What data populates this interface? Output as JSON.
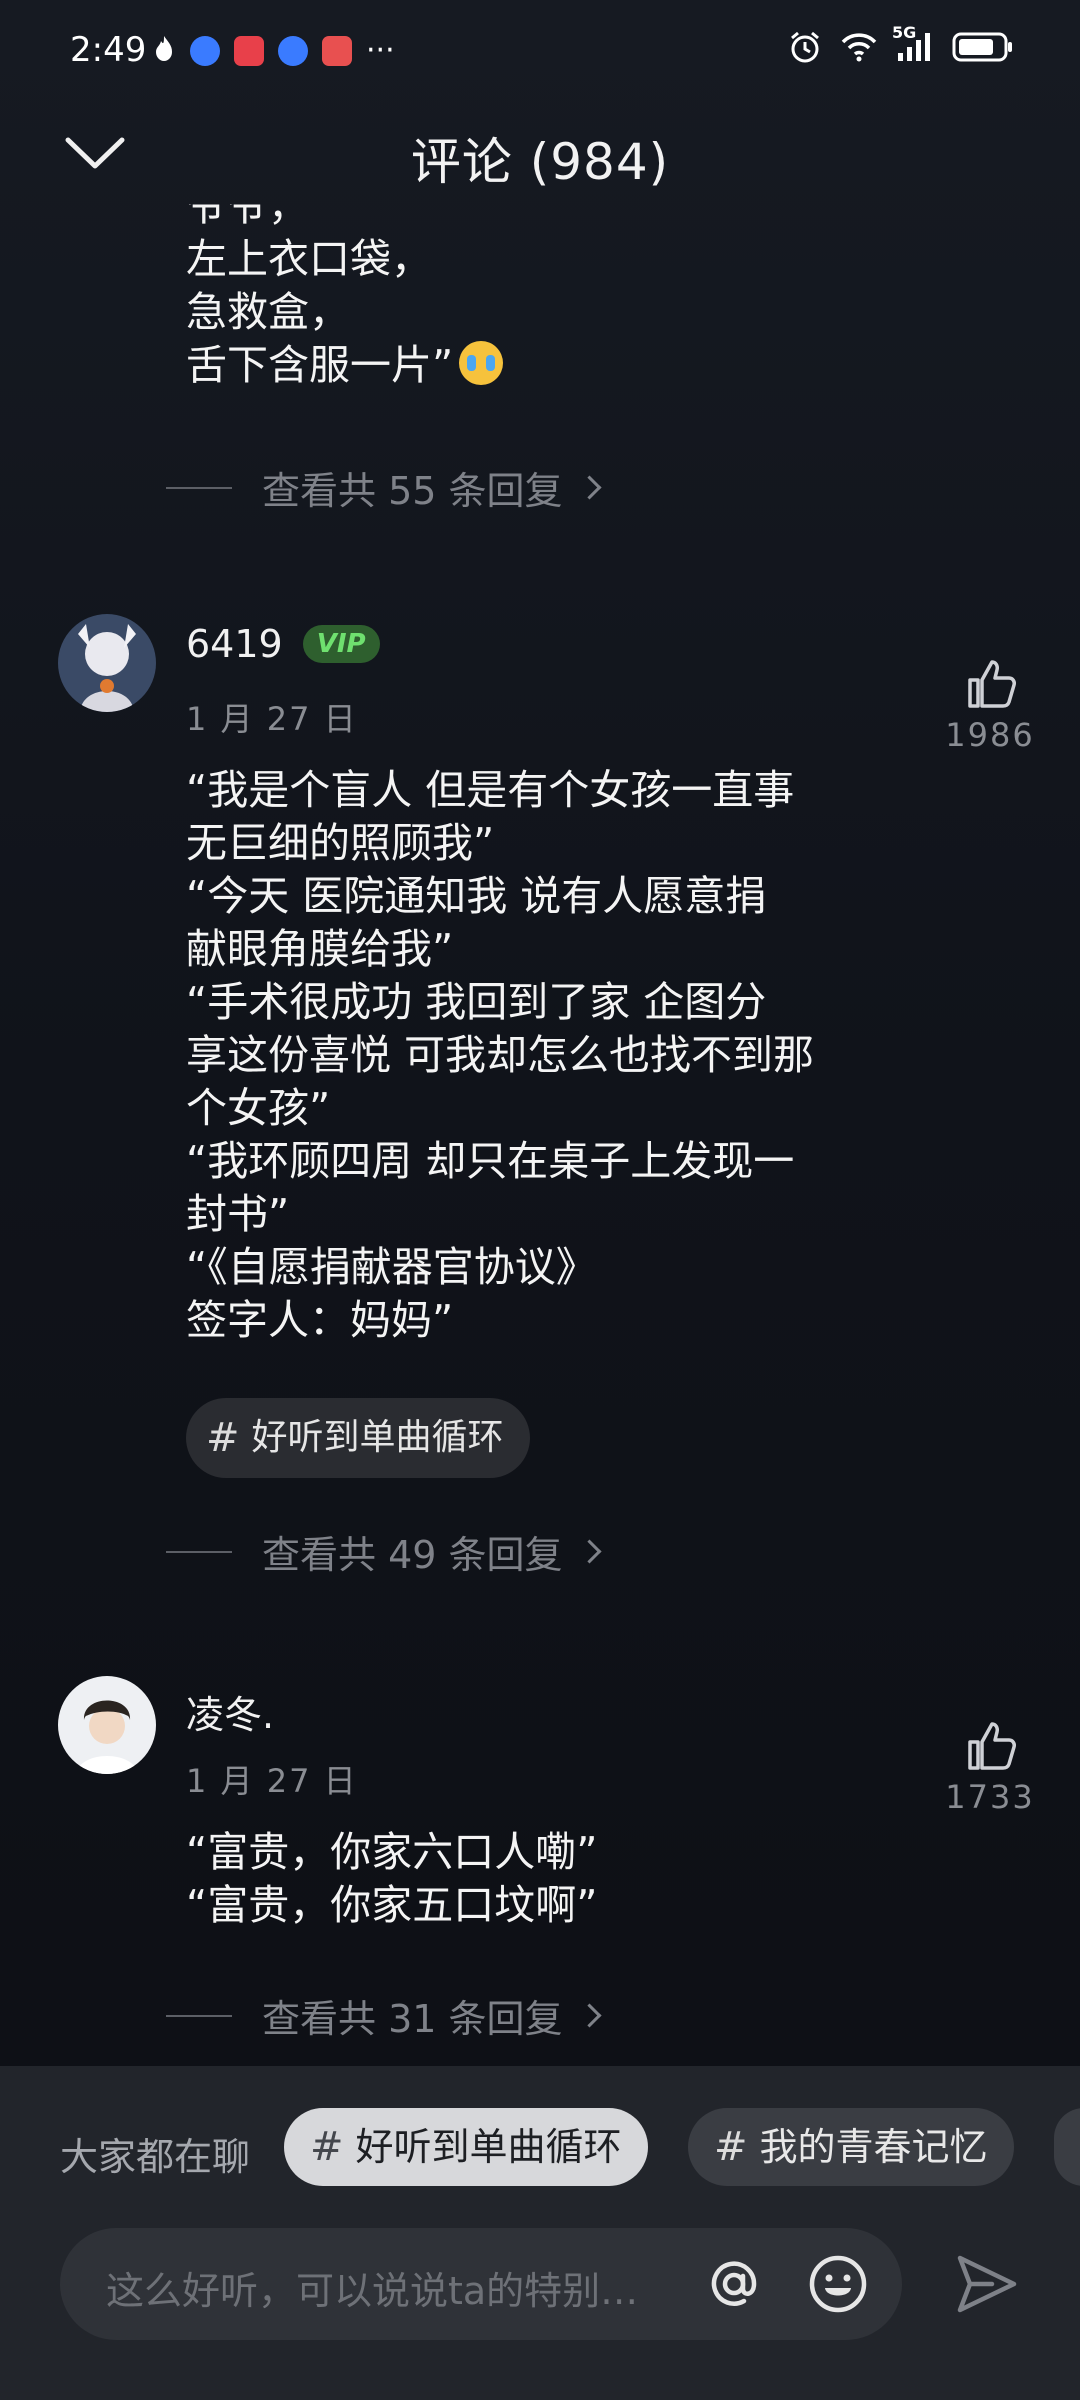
{
  "status_bar": {
    "time": "2:49",
    "overflow": "···",
    "network": "5G",
    "left_icons": [
      "flame-icon",
      "browser-icon",
      "app-icon",
      "browser-icon",
      "book-icon"
    ],
    "right_icons": [
      "alarm-icon",
      "wifi-icon",
      "signal-icon",
      "battery-icon"
    ]
  },
  "header": {
    "title": "评论 (984)",
    "collapse_icon": "chevron-down-icon"
  },
  "previous_comment": {
    "lines": [
      "爷爷，",
      "左上衣口袋，",
      "急救盒，",
      "舌下含服一片”"
    ],
    "emoji": "crying-face",
    "replies_label": "查看共 55 条回复"
  },
  "comments": [
    {
      "username": "6419",
      "badge": "VIP",
      "date": "1 月 27 日",
      "likes": "1986",
      "lines": [
        "“我是个盲人 但是有个女孩一直事",
        "无巨细的照顾我”",
        "“今天 医院通知我 说有人愿意捐",
        "献眼角膜给我”",
        "“手术很成功 我回到了家 企图分",
        "享这份喜悦 可我却怎么也找不到那",
        "个女孩”",
        "“我环顾四周 却只在桌子上发现一",
        "封书”",
        "“《自愿捐献器官协议》",
        " 签字人：妈妈”"
      ],
      "topic_tag": "好听到单曲循环",
      "replies_label": "查看共 49 条回复"
    },
    {
      "username": "凌冬.",
      "date": "1 月 27 日",
      "likes": "1733",
      "lines": [
        "“富贵，你家六口人嘞”",
        "“富贵，你家五口坟啊”"
      ],
      "replies_label": "查看共 31 条回复"
    }
  ],
  "bottom_panel": {
    "chat_label": "大家都在聊",
    "topics": [
      "好听到单曲循环",
      "我的青春记忆"
    ],
    "input_placeholder": "这么好听，可以说说ta的特别…",
    "at_icon": "at-icon",
    "emoji_icon": "smiley-icon",
    "send_icon": "send-icon"
  },
  "colors": {
    "background": "#10131a",
    "panel": "#22252b",
    "vip_green": "#6fe06f",
    "muted_text": "#8a8d93"
  }
}
